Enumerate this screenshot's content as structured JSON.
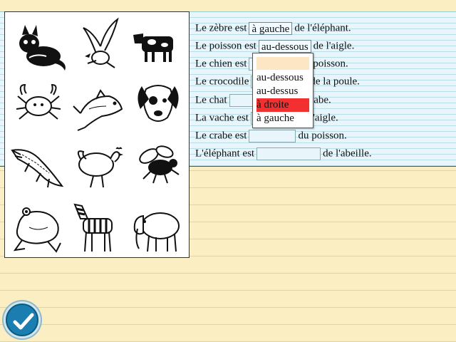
{
  "exercise": {
    "sentences": [
      {
        "before": "Le zèbre est",
        "answer": "à gauche",
        "after": "de l'éléphant."
      },
      {
        "before": "Le poisson est",
        "answer": "au-dessous",
        "after": "de l'aigle."
      },
      {
        "before": "Le chien est",
        "answer": "",
        "after": "du poisson."
      },
      {
        "before": "Le crocodile",
        "answer": "",
        "after": "de la poule."
      },
      {
        "before": "Le chat",
        "answer": "",
        "after": "crabe."
      },
      {
        "before": "La vache est",
        "answer": "",
        "after": "l'aigle."
      },
      {
        "before": "Le crabe est",
        "answer": "",
        "after": "du poisson."
      },
      {
        "before": "L'éléphant est",
        "answer": "",
        "after": "de l'abeille."
      }
    ]
  },
  "dropdown": {
    "options": [
      "au-dessous",
      "au-dessus",
      "à droite",
      "à gauche"
    ],
    "selected": "à droite"
  },
  "animals": [
    "cat-icon",
    "eagle-icon",
    "cow-icon",
    "crab-icon",
    "fish-icon",
    "dog-icon",
    "crocodile-icon",
    "hen-icon",
    "bee-icon",
    "frog-icon",
    "zebra-icon",
    "elephant-icon"
  ],
  "colors": {
    "paper": "#fbeec2",
    "notebook": "#e8f5fb",
    "highlight": "#f23030",
    "dropdown_blank": "#fde6c3",
    "ok_button": "#1a7fb0"
  }
}
